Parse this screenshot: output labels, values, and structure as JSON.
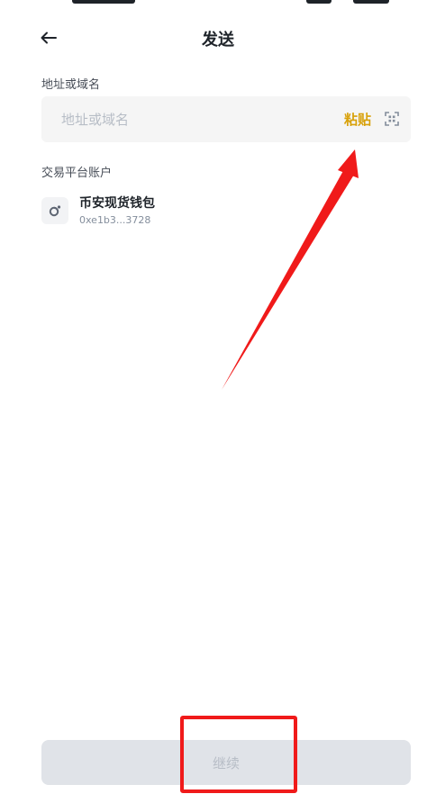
{
  "header": {
    "title": "发送"
  },
  "address": {
    "label": "地址或域名",
    "placeholder": "地址或域名",
    "value": "",
    "paste_label": "粘贴"
  },
  "exchange": {
    "label": "交易平台账户",
    "accounts": [
      {
        "name": "币安现货钱包",
        "address": "0xe1b3...3728"
      }
    ]
  },
  "footer": {
    "continue_label": "继续"
  },
  "colors": {
    "accent": "#d8a10a",
    "annotation": "#f01a1a",
    "disabled_button": "#e0e3e8"
  }
}
